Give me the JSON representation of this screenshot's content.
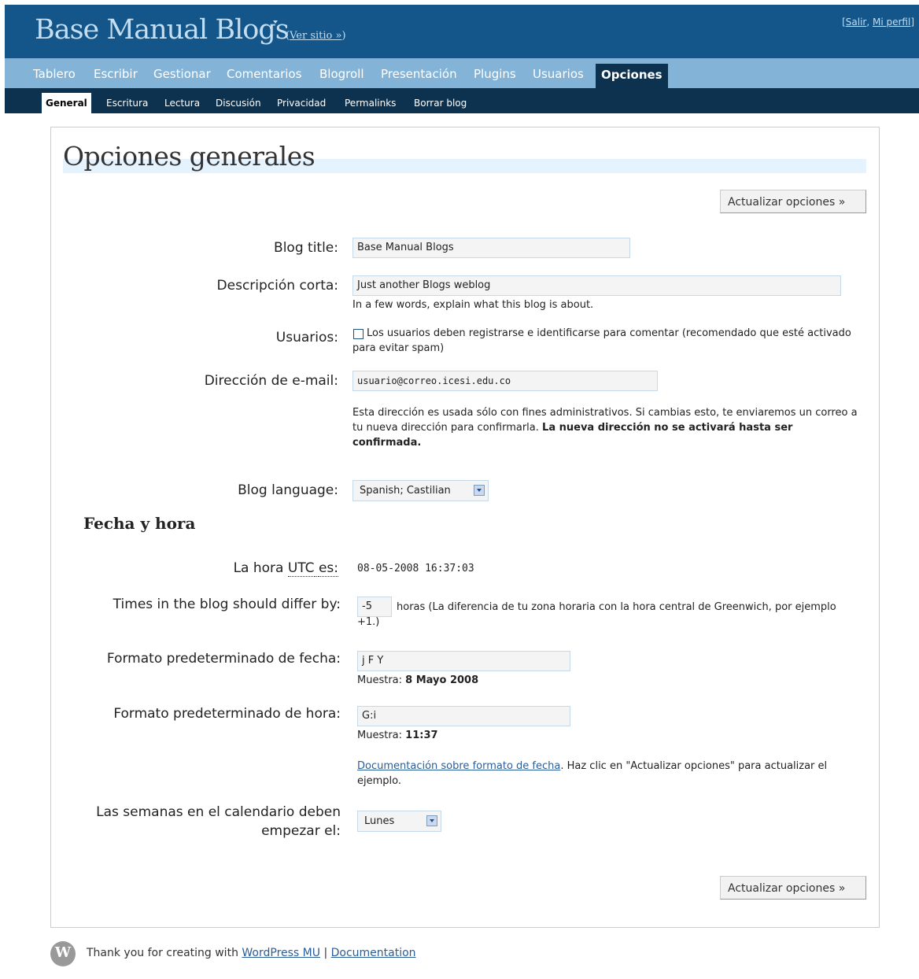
{
  "header": {
    "site_title": "Base Manual Blogs",
    "view_site": "Ver sitio »",
    "logout": "Salir",
    "profile": "Mi perfil"
  },
  "menu": [
    "Tablero",
    "Escribir",
    "Gestionar",
    "Comentarios",
    "Blogroll",
    "Presentación",
    "Plugins",
    "Usuarios",
    "Opciones"
  ],
  "submenu": [
    "General",
    "Escritura",
    "Lectura",
    "Discusión",
    "Privacidad",
    "Permalinks",
    "Borrar blog"
  ],
  "page": {
    "title": "Opciones generales",
    "update_button": "Actualizar opciones »"
  },
  "form": {
    "blog_title_label": "Blog title:",
    "blog_title_value": "Base Manual Blogs",
    "tagline_label": "Descripción corta:",
    "tagline_value": "Just another Blogs weblog",
    "tagline_help": "In a few words, explain what this blog is about.",
    "users_label": "Usuarios:",
    "users_checkbox_text": "Los usuarios deben registrarse e identificarse para comentar (recomendado que esté activado para evitar spam)",
    "email_label": "Dirección de e-mail:",
    "email_value": "usuario@correo.icesi.edu.co",
    "email_help": "Esta dirección es usada sólo con fines administrativos. Si cambias esto, te enviaremos un correo a tu nueva dirección para confirmarla.",
    "email_help_bold": "La nueva dirección no se activará hasta ser confirmada.",
    "language_label": "Blog language:",
    "language_value": "Spanish; Castilian",
    "datetime_heading": "Fecha y hora",
    "utc_label_prefix": "La hora",
    "utc_abbr": "UTC",
    "utc_label_suffix": "es:",
    "utc_value": "08-05-2008 16:37:03",
    "offset_label": "Times in the blog should differ by:",
    "offset_value": "-5",
    "offset_help": "horas (La diferencia de tu zona horaria con la hora central de Greenwich, por ejemplo +1.)",
    "date_format_label": "Formato predeterminado de fecha:",
    "date_format_value": "j F Y",
    "sample_prefix": "Muestra:",
    "date_sample": "8 Mayo 2008",
    "time_format_label": "Formato predeterminado de hora:",
    "time_format_value": "G:i",
    "time_sample": "11:37",
    "doc_link": "Documentación sobre formato de fecha",
    "doc_help": ". Haz clic en \"Actualizar opciones\" para actualizar el ejemplo.",
    "week_label": "Las semanas en el calendario deben empezar el:",
    "week_value": "Lunes"
  },
  "footer": {
    "text": "Thank you for creating with",
    "wpmu_link": "WordPress MU",
    "separator": "|",
    "doc_link": "Documentation"
  }
}
